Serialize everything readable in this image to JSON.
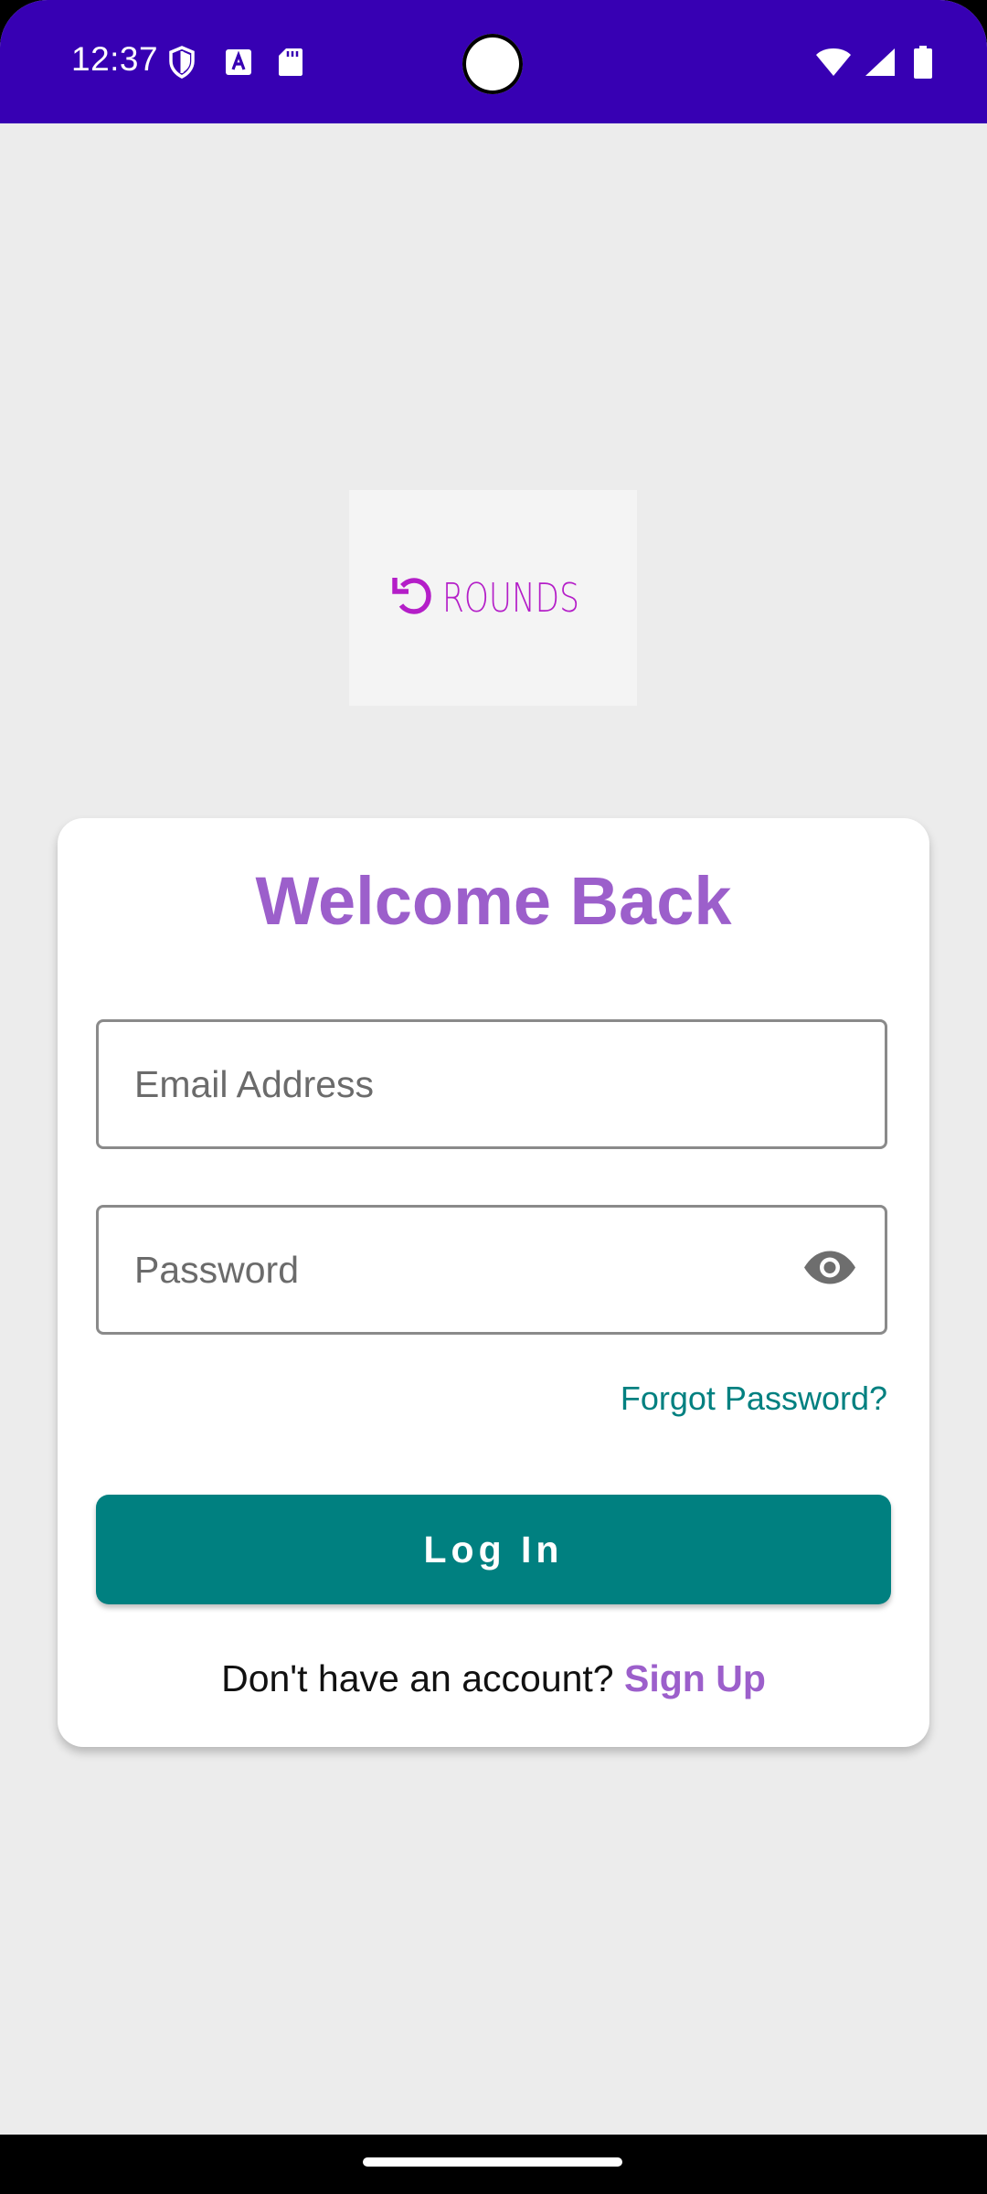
{
  "status_bar": {
    "time": "12:37",
    "icons_left": [
      "shield-icon",
      "text-a-icon",
      "sd-card-icon"
    ],
    "icons_right": [
      "wifi-icon",
      "signal-icon",
      "battery-icon"
    ],
    "background": "#3700b3"
  },
  "logo": {
    "text": "ROUNDS",
    "color": "#b41ec8"
  },
  "login_card": {
    "title": "Welcome Back",
    "email_placeholder": "Email Address",
    "password_placeholder": "Password",
    "forgot_password_label": "Forgot Password?",
    "login_button_label": "Log In",
    "signup_prompt": "Don't have an account?",
    "signup_label": "Sign Up"
  },
  "colors": {
    "accent_purple": "#9c5fcb",
    "primary_teal": "#008080",
    "background": "#ececec"
  }
}
